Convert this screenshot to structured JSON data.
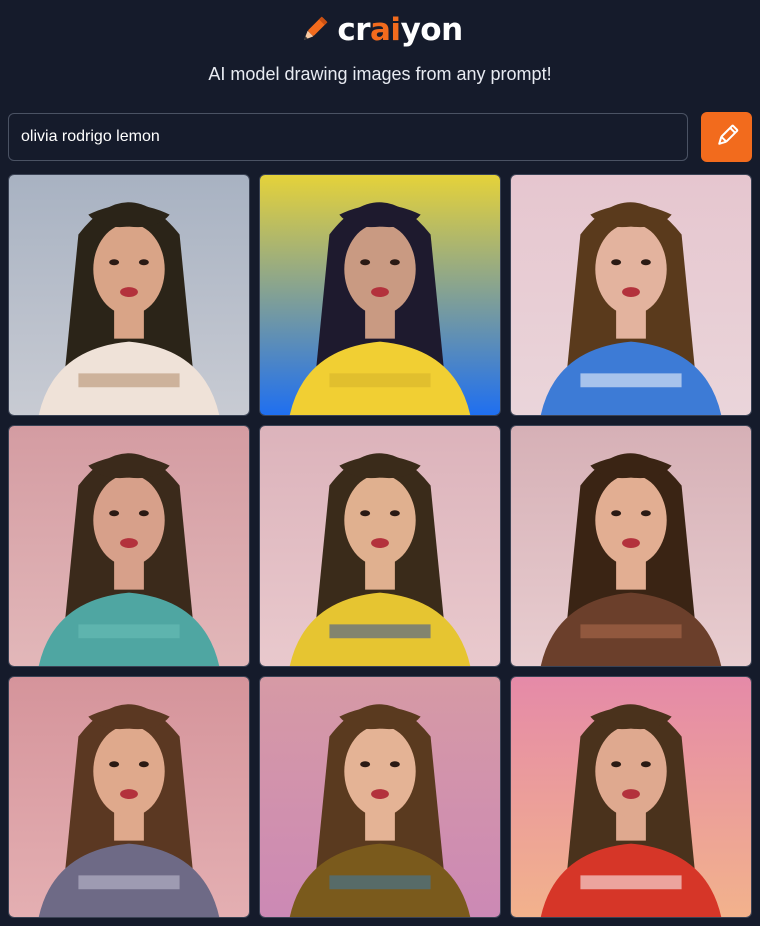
{
  "brand": {
    "name_pre": "cr",
    "name_accent": "ai",
    "name_post": "yon",
    "logo_icon": "pencil-icon",
    "accent_color": "#f26b1d"
  },
  "tagline": "AI model drawing images from any prompt!",
  "search": {
    "value": "olivia rodrigo lemon",
    "button_icon": "pencil-icon"
  },
  "results": [
    {
      "bg": "#a8b2c2",
      "bg2": "#c8cbd3",
      "hair": "#2b2418",
      "skin": "#d9a487",
      "top": "#efe2d8",
      "accent": "#b08a6a"
    },
    {
      "bg": "#e5d23a",
      "bg2": "#1f6ff0",
      "hair": "#1e1a2e",
      "skin": "#c99a82",
      "top": "#f1cf33",
      "accent": "#d4b22a"
    },
    {
      "bg": "#e6c6cf",
      "bg2": "#ead5da",
      "hair": "#5a3a1c",
      "skin": "#e3b39e",
      "top": "#3d7bd6",
      "accent": "#ffffff"
    },
    {
      "bg": "#d49ca2",
      "bg2": "#e2b7b9",
      "hair": "#3b2a1b",
      "skin": "#d7a08a",
      "top": "#4fa6a2",
      "accent": "#6bc0b8"
    },
    {
      "bg": "#dcb3bb",
      "bg2": "#e9c9cd",
      "hair": "#3a2b1a",
      "skin": "#e0b08f",
      "top": "#e6c531",
      "accent": "#2f4ea0"
    },
    {
      "bg": "#d6b0b6",
      "bg2": "#e8cdd0",
      "hair": "#3a2414",
      "skin": "#e2ae92",
      "top": "#6b3f2b",
      "accent": "#b06e4e"
    },
    {
      "bg": "#d5949b",
      "bg2": "#e4afb2",
      "hair": "#5b3822",
      "skin": "#dfa98c",
      "top": "#6e6a86",
      "accent": "#c7c3d7"
    },
    {
      "bg": "#d69aa5",
      "bg2": "#cc89b5",
      "hair": "#5a3a1f",
      "skin": "#e4b395",
      "top": "#7a5a1c",
      "accent": "#3a7aa7"
    },
    {
      "bg": "#e58aa8",
      "bg2": "#f2b28c",
      "hair": "#4a321c",
      "skin": "#dfa98f",
      "top": "#d63628",
      "accent": "#ffffff"
    }
  ]
}
